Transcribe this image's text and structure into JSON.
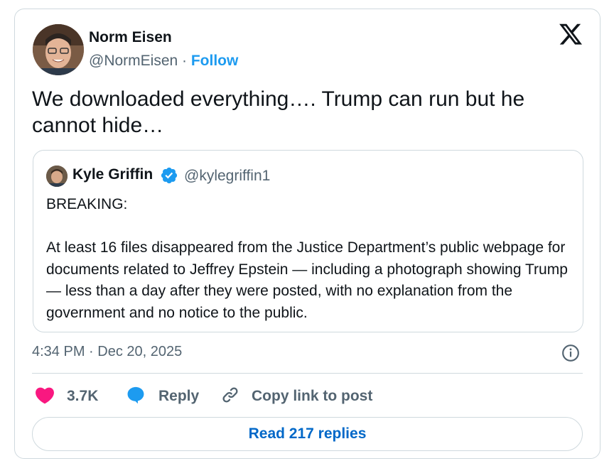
{
  "tweet": {
    "author": {
      "name": "Norm Eisen",
      "handle": "@NormEisen",
      "separator": " · ",
      "follow_label": "Follow"
    },
    "text": "We downloaded everything…. Trump can run but he cannot hide…",
    "timestamp": "4:34 PM · Dec 20, 2025"
  },
  "quoted_tweet": {
    "name": "Kyle Griffin",
    "handle": "@kylegriffin1",
    "text": "BREAKING:\n\nAt least 16 files disappeared from the Justice Department’s public webpage for documents related to Jeffrey Epstein — including a photograph showing Trump — less than a day after they were posted, with no explanation from the government and no notice to the public."
  },
  "actions": {
    "like_count": "3.7K",
    "reply_label": "Reply",
    "copy_link_label": "Copy link to post"
  },
  "read_replies_label": "Read 217 replies",
  "colors": {
    "accent": "#1d9bf0",
    "link_button": "#0068c8",
    "like": "#f91880",
    "muted": "#536471",
    "border": "#cfd9de"
  },
  "icons": {
    "brand": "x-logo-icon",
    "verified": "verified-badge-icon",
    "info": "info-icon",
    "like": "heart-icon",
    "reply": "reply-bubble-icon",
    "copy": "link-icon"
  }
}
